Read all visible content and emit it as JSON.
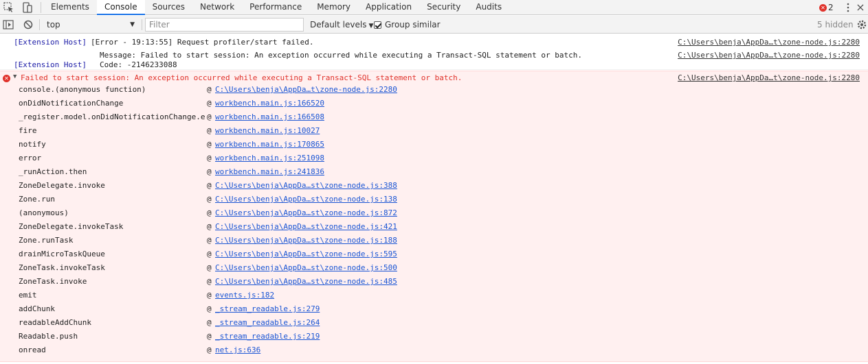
{
  "tabs": [
    "Elements",
    "Console",
    "Sources",
    "Network",
    "Performance",
    "Memory",
    "Application",
    "Security",
    "Audits"
  ],
  "error_count": "2",
  "toolbar": {
    "context": "top",
    "filter_placeholder": "Filter",
    "levels": "Default levels",
    "group_similar": "Group similar",
    "hidden": "5 hidden"
  },
  "log1": {
    "line1_source": "[Extension Host]",
    "line1_text": "[Error - 19:13:55] Request profiler/start failed.",
    "line1_link": "C:\\Users\\benja\\AppDa…t\\zone-node.js:2280",
    "line2_text": "Message: Failed to start session: An exception occurred while executing a Transact-SQL statement or batch.",
    "line2_link": "C:\\Users\\benja\\AppDa…t\\zone-node.js:2280",
    "line3_source": "[Extension Host]",
    "line3_text": "Code: -2146233088"
  },
  "error": {
    "message": "Failed to start session: An exception occurred while executing a Transact-SQL statement or batch.",
    "link": "C:\\Users\\benja\\AppDa…t\\zone-node.js:2280",
    "frames": [
      {
        "fn": "console.(anonymous function)",
        "loc": "C:\\Users\\benja\\AppDa…t\\zone-node.js:2280"
      },
      {
        "fn": "onDidNotificationChange",
        "loc": "workbench.main.js:166520"
      },
      {
        "fn": "_register.model.onDidNotificationChange.e",
        "loc": "workbench.main.js:166508"
      },
      {
        "fn": "fire",
        "loc": "workbench.main.js:10027"
      },
      {
        "fn": "notify",
        "loc": "workbench.main.js:170865"
      },
      {
        "fn": "error",
        "loc": "workbench.main.js:251098"
      },
      {
        "fn": "_runAction.then",
        "loc": "workbench.main.js:241836"
      },
      {
        "fn": "ZoneDelegate.invoke",
        "loc": "C:\\Users\\benja\\AppDa…st\\zone-node.js:388"
      },
      {
        "fn": "Zone.run",
        "loc": "C:\\Users\\benja\\AppDa…st\\zone-node.js:138"
      },
      {
        "fn": "(anonymous)",
        "loc": "C:\\Users\\benja\\AppDa…st\\zone-node.js:872"
      },
      {
        "fn": "ZoneDelegate.invokeTask",
        "loc": "C:\\Users\\benja\\AppDa…st\\zone-node.js:421"
      },
      {
        "fn": "Zone.runTask",
        "loc": "C:\\Users\\benja\\AppDa…st\\zone-node.js:188"
      },
      {
        "fn": "drainMicroTaskQueue",
        "loc": "C:\\Users\\benja\\AppDa…st\\zone-node.js:595"
      },
      {
        "fn": "ZoneTask.invokeTask",
        "loc": "C:\\Users\\benja\\AppDa…st\\zone-node.js:500"
      },
      {
        "fn": "ZoneTask.invoke",
        "loc": "C:\\Users\\benja\\AppDa…st\\zone-node.js:485"
      },
      {
        "fn": "emit",
        "loc": "events.js:182"
      },
      {
        "fn": "addChunk",
        "loc": "_stream_readable.js:279"
      },
      {
        "fn": "readableAddChunk",
        "loc": "_stream_readable.js:264"
      },
      {
        "fn": "Readable.push",
        "loc": "_stream_readable.js:219"
      },
      {
        "fn": "onread",
        "loc": "net.js:636"
      }
    ]
  }
}
